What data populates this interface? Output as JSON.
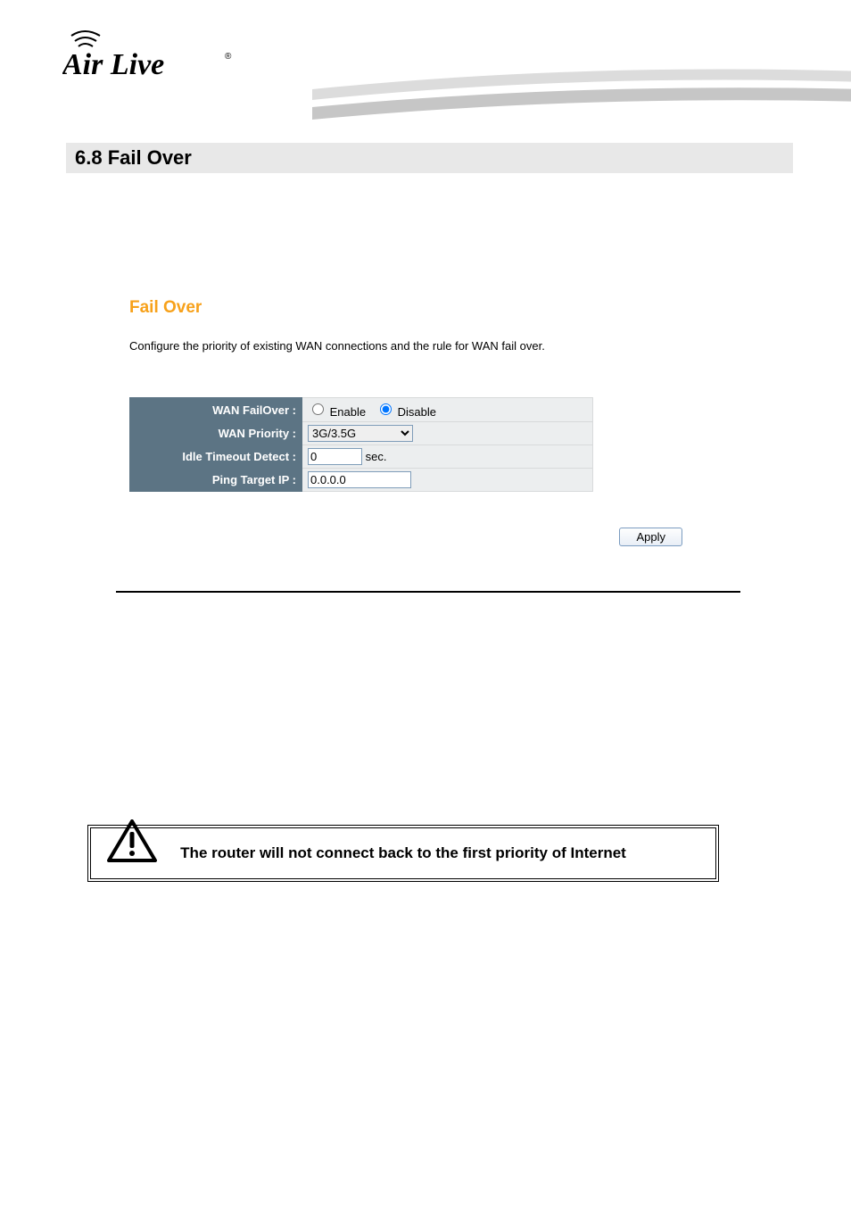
{
  "logo_text": "Air Live",
  "section_heading": "6.8 Fail  Over",
  "panel": {
    "title": "Fail Over",
    "description": "Configure the priority of existing WAN connections and the rule for WAN fail over."
  },
  "form": {
    "rows": {
      "failover": {
        "label": "WAN FailOver :",
        "enable_label": "Enable",
        "disable_label": "Disable",
        "selected": "disable"
      },
      "priority": {
        "label": "WAN Priority :",
        "value": "3G/3.5G"
      },
      "idle": {
        "label": "Idle Timeout Detect :",
        "value": "0",
        "unit": "sec."
      },
      "ping": {
        "label": "Ping Target IP :",
        "value": "0.0.0.0"
      }
    },
    "apply_label": "Apply"
  },
  "warning_text": "The router will not connect back to the first priority of Internet"
}
